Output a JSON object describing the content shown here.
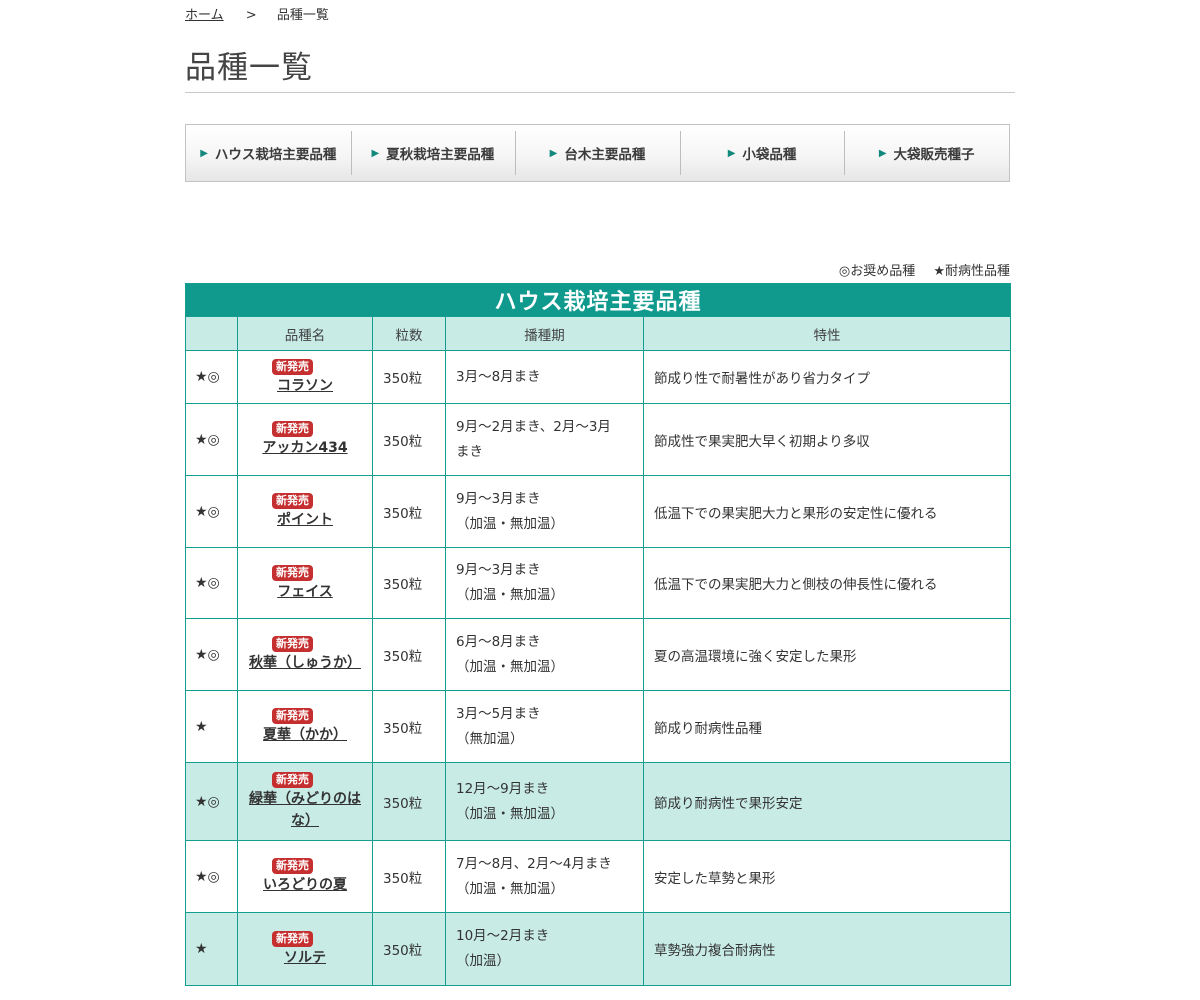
{
  "breadcrumb": {
    "home": "ホーム",
    "separator": ">",
    "current": "品種一覧"
  },
  "page_title": "品種一覧",
  "tabs": [
    {
      "label": "ハウス栽培主要品種"
    },
    {
      "label": "夏秋栽培主要品種"
    },
    {
      "label": "台木主要品種"
    },
    {
      "label": "小袋品種"
    },
    {
      "label": "大袋販売種子"
    }
  ],
  "legend": {
    "recommended": "◎お奨め品種",
    "resistant": "★耐病性品種"
  },
  "table": {
    "caption": "ハウス栽培主要品種",
    "headers": {
      "mark": "",
      "name": "品種名",
      "qty": "粒数",
      "sowing": "播種期",
      "traits": "特性"
    },
    "badge": "新発売",
    "rows": [
      {
        "mark": "★◎",
        "name": "コラソン",
        "qty": "350粒",
        "sow1": "3月〜8月まき",
        "sow2": "",
        "traits": "節成り性で耐暑性があり省力タイプ",
        "alt": false
      },
      {
        "mark": "★◎",
        "name": "アッカン434",
        "qty": "350粒",
        "sow1": "9月〜2月まき、2月〜3月",
        "sow2": "まき",
        "traits": "節成性で果実肥大早く初期より多収",
        "alt": false
      },
      {
        "mark": "★◎",
        "name": "ポイント",
        "qty": "350粒",
        "sow1": "9月〜3月まき",
        "sow2": "（加温・無加温）",
        "traits": "低温下での果実肥大力と果形の安定性に優れる",
        "alt": false
      },
      {
        "mark": "★◎",
        "name": "フェイス",
        "qty": "350粒",
        "sow1": "9月〜3月まき",
        "sow2": "（加温・無加温）",
        "traits": "低温下での果実肥大力と側枝の伸長性に優れる",
        "alt": false
      },
      {
        "mark": "★◎",
        "name": "秋華（しゅうか）",
        "qty": "350粒",
        "sow1": "6月〜8月まき",
        "sow2": "（加温・無加温）",
        "traits": "夏の高温環境に強く安定した果形",
        "alt": false
      },
      {
        "mark": "★",
        "name": "夏華（かか）",
        "qty": "350粒",
        "sow1": "3月〜5月まき",
        "sow2": "（無加温）",
        "traits": "節成り耐病性品種",
        "alt": false
      },
      {
        "mark": "★◎",
        "name": "緑華（みどりのはな）",
        "qty": "350粒",
        "sow1": "12月〜9月まき",
        "sow2": "（加温・無加温）",
        "traits": "節成り耐病性で果形安定",
        "alt": true
      },
      {
        "mark": "★◎",
        "name": "いろどりの夏",
        "qty": "350粒",
        "sow1": "7月〜8月、2月〜4月まき",
        "sow2": "（加温・無加温）",
        "traits": "安定した草勢と果形",
        "alt": false
      },
      {
        "mark": "★",
        "name": "ソルテ",
        "qty": "350粒",
        "sow1": "10月〜2月まき",
        "sow2": "（加温）",
        "traits": "草勢強力複合耐病性",
        "alt": true
      }
    ]
  }
}
